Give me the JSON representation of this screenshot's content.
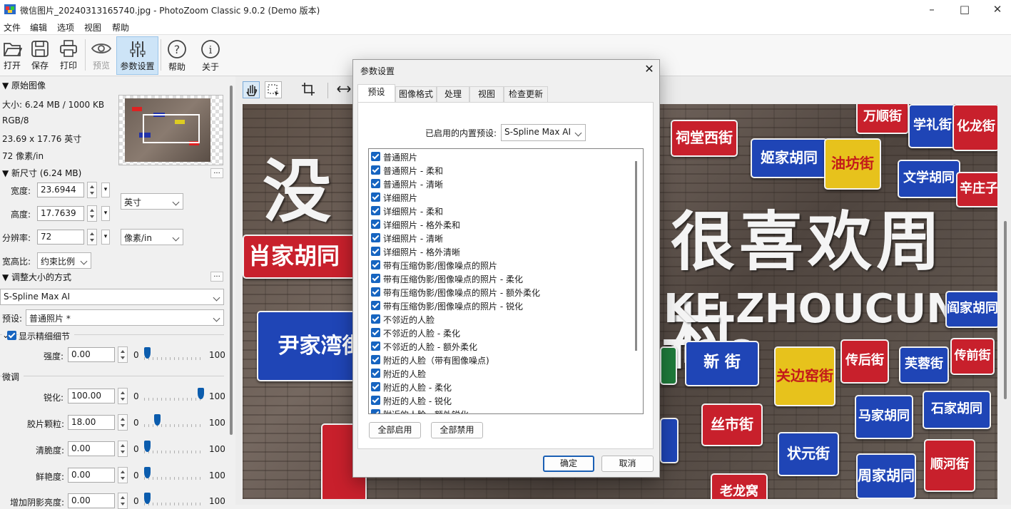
{
  "window": {
    "title": "微信图片_20240313165740.jpg - PhotoZoom Classic 9.0.2 (Demo 版本)"
  },
  "menu": [
    "文件",
    "编辑",
    "选项",
    "视图",
    "帮助"
  ],
  "toolbar": {
    "open": "打开",
    "save": "保存",
    "print": "打印",
    "preview": "预览",
    "params": "参数设置",
    "help": "帮助",
    "about": "关于"
  },
  "left": {
    "original_title": "▼ 原始图像",
    "size": "大小: 6.24 MB / 1000 KB",
    "mode": "RGB/8",
    "dims": "23.69 x 17.76 英寸",
    "res": "72 像素/in",
    "newsize_title": "▼ 新尺寸 (6.24 MB)",
    "width_label": "宽度:",
    "width_value": "23.6944",
    "height_label": "高度:",
    "height_value": "17.7639",
    "res_label": "分辨率:",
    "res_value": "72",
    "unit_size": "英寸",
    "unit_res": "像素/in",
    "ratio_label": "宽高比:",
    "ratio_value": "约束比例",
    "method_title": "▼ 调整大小的方式",
    "method_value": "S-Spline Max AI",
    "preset_label": "预设:",
    "preset_value": "普通照片 *",
    "show_detail": "显示精细细节",
    "strength_label": "强度:",
    "strength_value": "0.00",
    "finetune_title": "微调",
    "sharpen_label": "锐化:",
    "sharpen_value": "100.00",
    "grain_label": "胶片颗粒:",
    "grain_value": "18.00",
    "crisp_label": "清脆度:",
    "crisp_value": "0.00",
    "vivid_label": "鲜艳度:",
    "vivid_value": "0.00",
    "shadow_label": "增加阴影亮度:",
    "shadow_value": "0.00",
    "min": "0",
    "max": "100",
    "sliders": {
      "strength": 0,
      "sharpen": 1.0,
      "grain": 0.18,
      "crisp": 0,
      "vivid": 0,
      "shadow": 0
    }
  },
  "photo": {
    "signs": [
      "祠堂西街",
      "姬家胡同",
      "油坊街",
      "文学胡同",
      "辛庄子",
      "肖家胡同",
      "尹家湾街",
      "新 街",
      "关边窑街",
      "传后街",
      "芙蓉街",
      "传前街",
      "丝市街",
      "马家胡同",
      "石家胡同",
      "状元街",
      "周家胡同",
      "顺河街",
      "老龙窝",
      "阎家胡同",
      "万顺街",
      "学礼街",
      "化龙街"
    ],
    "slogan": "很喜欢周村",
    "slogan2": "KE ZHOUCUN TOO",
    "char1": "没"
  },
  "dialog": {
    "title": "参数设置",
    "tabs": [
      "预设",
      "图像格式",
      "处理",
      "视图",
      "检查更新"
    ],
    "preset_label": "已启用的内置预设:",
    "preset_value": "S-Spline Max AI",
    "items": [
      "普通照片",
      "普通照片 - 柔和",
      "普通照片 - 清晰",
      "详细照片",
      "详细照片 - 柔和",
      "详细照片 - 格外柔和",
      "详细照片 - 清晰",
      "详细照片 - 格外清晰",
      "带有压缩伪影/图像噪点的照片",
      "带有压缩伪影/图像噪点的照片 - 柔化",
      "带有压缩伪影/图像噪点的照片 - 额外柔化",
      "带有压缩伪影/图像噪点的照片 - 锐化",
      "不邻近的人脸",
      "不邻近的人脸 - 柔化",
      "不邻近的人脸 - 额外柔化",
      "附近的人脸（带有图像噪点)",
      "附近的人脸",
      "附近的人脸 - 柔化",
      "附近的人脸 - 锐化",
      "附近的人脸 - 额外锐化"
    ],
    "enable_all": "全部启用",
    "disable_all": "全部禁用",
    "ok": "确定",
    "cancel": "取消"
  }
}
